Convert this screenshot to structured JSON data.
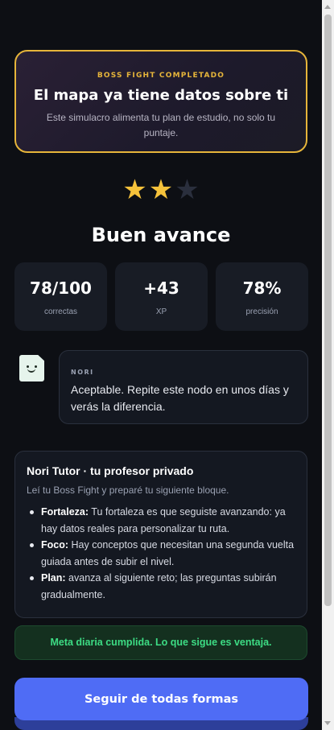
{
  "banner": {
    "kicker": "BOSS FIGHT COMPLETADO",
    "title": "El mapa ya tiene datos sobre ti",
    "subtitle": "Este simulacro alimenta tu plan de estudio, no solo tu puntaje."
  },
  "rating": {
    "stars_filled": 2,
    "stars_total": 3
  },
  "result_title": "Buen avance",
  "stats": [
    {
      "value": "78/100",
      "label": "correctas"
    },
    {
      "value": "+43",
      "label": "XP"
    },
    {
      "value": "78%",
      "label": "precisión"
    }
  ],
  "nori": {
    "name": "NORI",
    "message": "Aceptable. Repite este nodo en unos días y verás la diferencia."
  },
  "tutor": {
    "title": "Nori Tutor · tu profesor privado",
    "subtitle": "Leí tu Boss Fight y preparé tu siguiente bloque.",
    "items": [
      {
        "label": "Fortaleza:",
        "text": " Tu fortaleza es que seguiste avanzando: ya hay datos reales para personalizar tu ruta."
      },
      {
        "label": "Foco:",
        "text": " Hay conceptos que necesitan una segunda vuelta guiada antes de subir el nivel."
      },
      {
        "label": "Plan:",
        "text": " avanza al siguiente reto; las preguntas subirán gradualmente."
      }
    ]
  },
  "goal_text": "Meta diaria cumplida. Lo que sigue es ventaja.",
  "cta_label": "Seguir de todas formas",
  "colors": {
    "gold": "#e6b53a",
    "accent": "#4f6cf5",
    "success": "#3ddc84"
  }
}
